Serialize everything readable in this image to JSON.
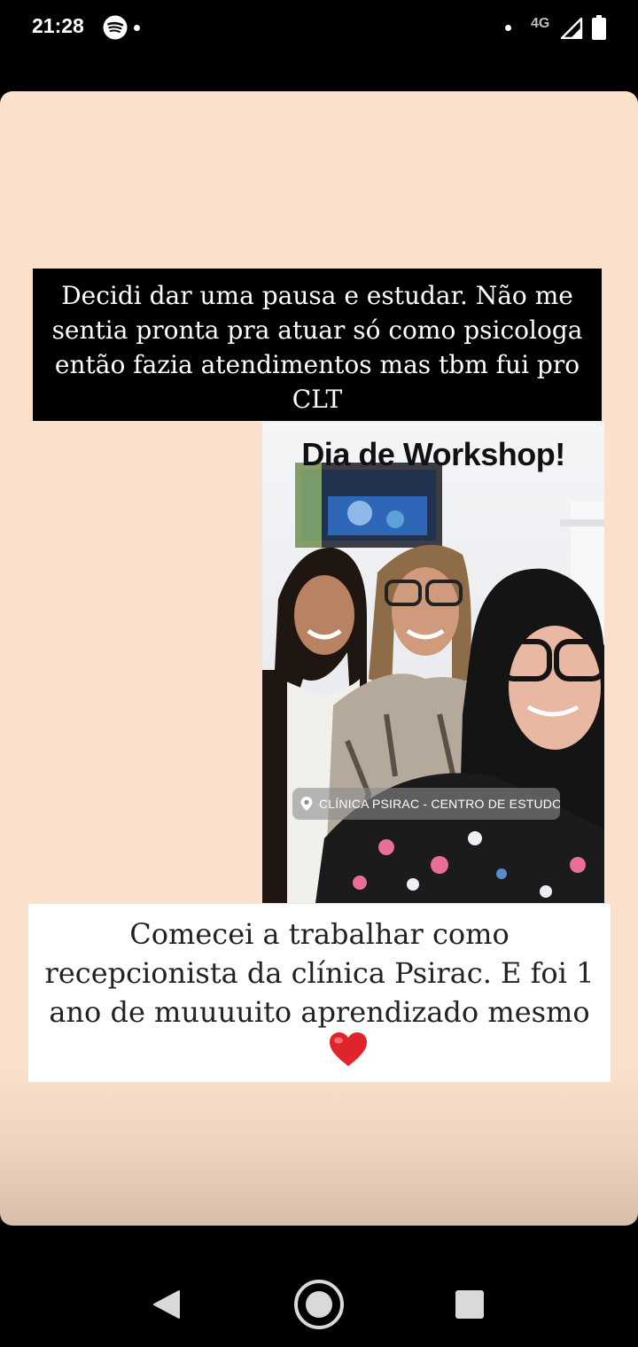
{
  "status_bar": {
    "time": "21:28",
    "network": "4G",
    "icons": [
      "spotify-icon",
      "notification-dot",
      "signal-icon",
      "battery-icon"
    ]
  },
  "story": {
    "caption_top": "Decidi dar uma pausa e estudar. Não me sentia pronta pra atuar só como psicologa então fazia atendimentos mas tbm fui pro CLT",
    "photo": {
      "title": "Dia de Workshop!",
      "location": "CLÍNICA PSIRAC - CENTRO DE ESTUDOS INTERD..."
    },
    "caption_bottom": "Comecei a trabalhar como recepcionista da clínica Psirac. E foi 1 ano de muuuuito aprendizado mesmo",
    "caption_emoji": "heart-emoji"
  },
  "nav_bar": {
    "buttons": [
      "back-button",
      "home-button",
      "recents-button"
    ]
  },
  "colors": {
    "story_background": "#fbe1cb",
    "caption_top_bg": "#000000",
    "caption_bottom_bg": "#ffffff",
    "heart": "#e0242c"
  }
}
